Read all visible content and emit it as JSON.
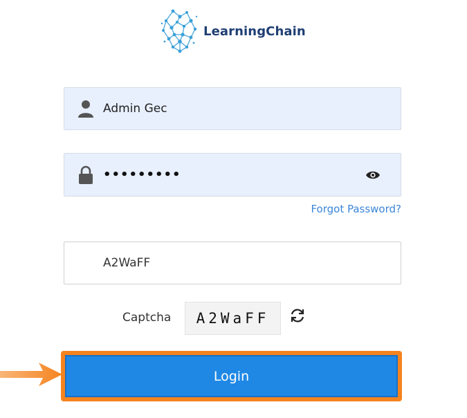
{
  "brand": {
    "name": "LearningChain"
  },
  "form": {
    "username_value": "Admin Gec",
    "password_value": "•••••••••",
    "forgot_password": "Forgot Password?",
    "captcha_input_value": "A2WaFF",
    "captcha_label": "Captcha",
    "captcha_code": "A2WaFF",
    "login_label": "Login"
  },
  "icons": {
    "username": "user-icon",
    "password": "lock-icon",
    "toggle_password": "eye-icon",
    "refresh_captcha": "refresh-icon",
    "annotation": "arrow-right-icon"
  },
  "colors": {
    "brand_text": "#1f3f73",
    "logo_blue": "#3aa0d8",
    "field_fill": "#e8f0fe",
    "link": "#3a86d9",
    "button": "#1f88e5",
    "highlight": "#f5841f"
  }
}
